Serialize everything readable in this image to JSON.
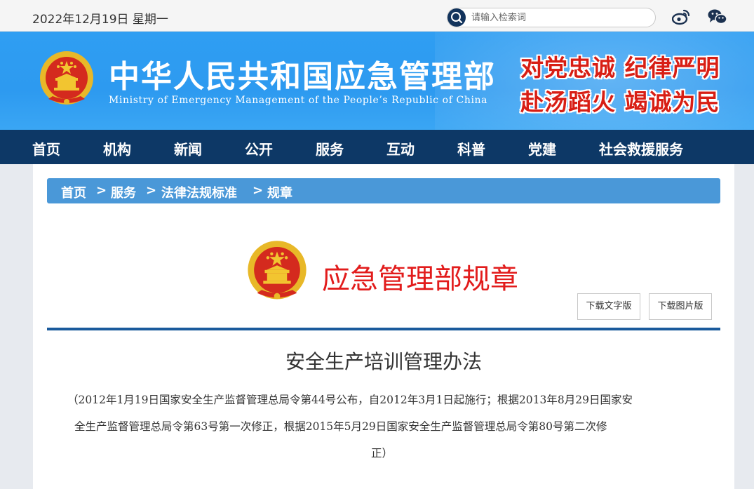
{
  "topbar": {
    "date": "2022年12月19日 星期一",
    "search_placeholder": "请输入检索词",
    "search_icon": "search-icon",
    "weibo_icon": "weibo-icon",
    "wechat_icon": "wechat-icon"
  },
  "banner": {
    "title": "中华人民共和国应急管理部",
    "subtitle": "Ministry of Emergency Management of the People’s Republic of China",
    "slogan_line1": "对党忠诚 纪律严明",
    "slogan_line2": "赴汤蹈火 竭诚为民"
  },
  "nav": {
    "items": [
      "首页",
      "机构",
      "新闻",
      "公开",
      "服务",
      "互动",
      "科普",
      "党建",
      "社会救援服务"
    ]
  },
  "breadcrumb": {
    "items": [
      "首页",
      "服务",
      "法律法规标准",
      "规章"
    ],
    "separator": ">"
  },
  "rules_header": {
    "title": "应急管理部规章",
    "download_text": "下载文字版",
    "download_image": "下载图片版"
  },
  "document": {
    "title": "安全生产培训管理办法",
    "note_line1": "（2012年1月19日国家安全生产监督管理总局令第44号公布，自2012年3月1日起施行；根据2013年8月29日国家安",
    "note_line2": "全生产监督管理总局令第63号第一次修正，根据2015年5月29日国家安全生产监督管理总局令第80号第二次修",
    "note_line3": "正）"
  },
  "colors": {
    "nav_bg": "#0d3866",
    "banner_bg": "#2f9ef2",
    "breadcrumb_bg": "#4a98d8",
    "accent_red": "#e21c1c",
    "divider": "#1a5a9c"
  }
}
